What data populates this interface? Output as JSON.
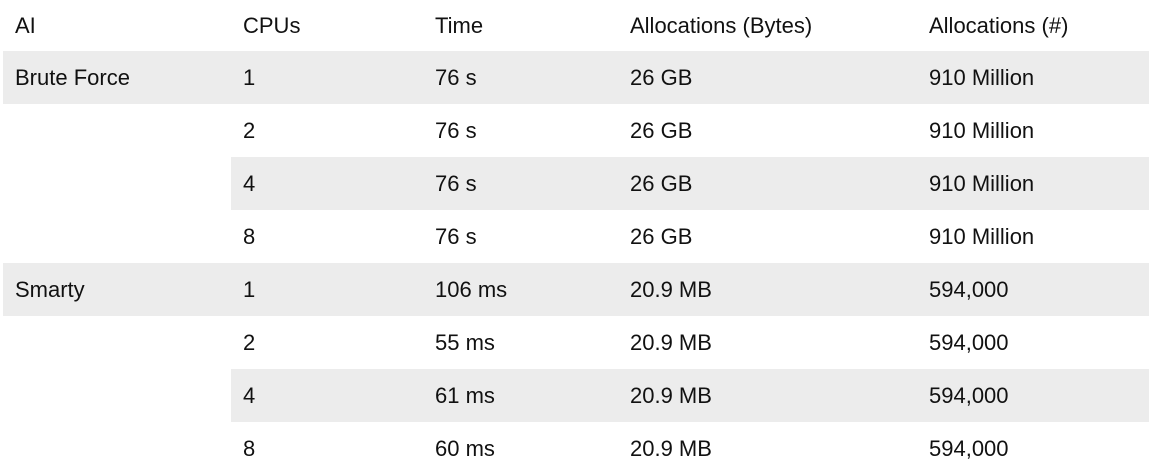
{
  "table": {
    "headers": [
      "AI",
      "CPUs",
      "Time",
      "Allocations (Bytes)",
      "Allocations (#)"
    ],
    "rows": [
      {
        "ai": "Brute Force",
        "cpus": "1",
        "time": "76 s",
        "bytes": "26 GB",
        "count": "910 Million",
        "shaded": "full"
      },
      {
        "ai": "",
        "cpus": "2",
        "time": "76 s",
        "bytes": "26 GB",
        "count": "910 Million",
        "shaded": "none"
      },
      {
        "ai": "",
        "cpus": "4",
        "time": "76 s",
        "bytes": "26 GB",
        "count": "910 Million",
        "shaded": "partial"
      },
      {
        "ai": "",
        "cpus": "8",
        "time": "76 s",
        "bytes": "26 GB",
        "count": "910 Million",
        "shaded": "none"
      },
      {
        "ai": "Smarty",
        "cpus": "1",
        "time": "106 ms",
        "bytes": "20.9 MB",
        "count": "594,000",
        "shaded": "full"
      },
      {
        "ai": "",
        "cpus": "2",
        "time": "55 ms",
        "bytes": "20.9 MB",
        "count": "594,000",
        "shaded": "none"
      },
      {
        "ai": "",
        "cpus": "4",
        "time": "61 ms",
        "bytes": "20.9 MB",
        "count": "594,000",
        "shaded": "partial"
      },
      {
        "ai": "",
        "cpus": "8",
        "time": "60 ms",
        "bytes": "20.9 MB",
        "count": "594,000",
        "shaded": "none"
      }
    ]
  },
  "colors": {
    "row_shade": "#ececec",
    "text": "#111111"
  }
}
